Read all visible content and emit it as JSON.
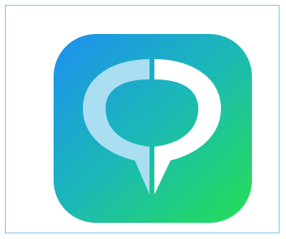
{
  "app_icon": {
    "name": "chat-pin-app-icon",
    "colors": {
      "gradient_start": "#1e8ff0",
      "gradient_mid": "#1bb9b5",
      "gradient_end": "#25e052",
      "left_half_fill": "#a9dff1",
      "right_half_fill": "#ffffff",
      "frame_border": "#7fc4ea"
    }
  }
}
